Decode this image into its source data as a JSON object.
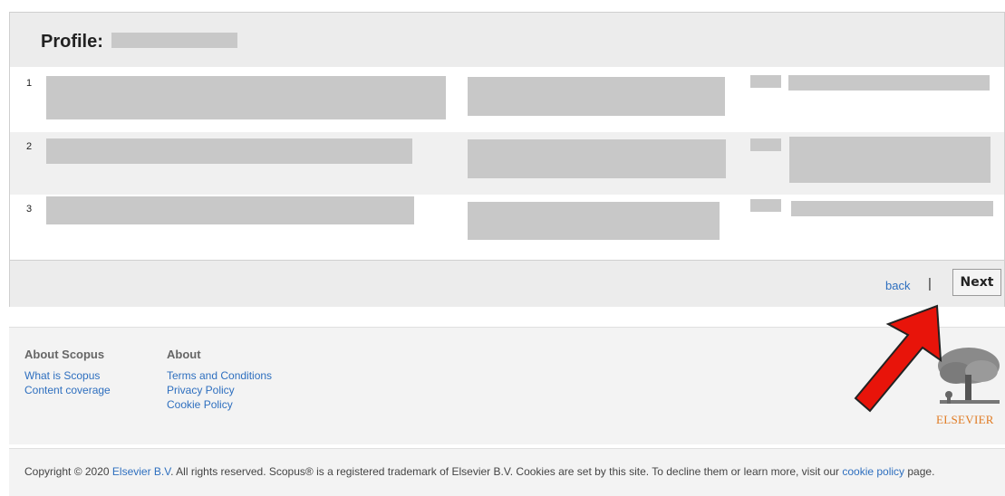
{
  "profile": {
    "label": "Profile:"
  },
  "rows": [
    {
      "num": "1"
    },
    {
      "num": "2"
    },
    {
      "num": "3"
    }
  ],
  "nav": {
    "back": "back",
    "separator": "|",
    "next": "Next"
  },
  "footer": {
    "about_scopus": {
      "title": "About Scopus",
      "links": [
        "What is Scopus",
        "Content coverage"
      ]
    },
    "about": {
      "title": "About",
      "links": [
        "Terms and Conditions",
        "Privacy Policy",
        "Cookie Policy"
      ]
    },
    "logo_text": "ELSEVIER"
  },
  "copyright": {
    "prefix": "Copyright © 2020 ",
    "company": "Elsevier B.V",
    "middle": ". All rights reserved. Scopus® is a registered trademark of Elsevier B.V. Cookies are set by this site. To decline them or learn more, visit our ",
    "cookie_link": "cookie policy",
    "suffix": " page."
  },
  "colors": {
    "link": "#2e6fbf",
    "arrow": "#e8140a",
    "logo": "#e07a21"
  },
  "icons": {
    "arrow": "red-arrow-annotation-icon",
    "logo": "elsevier-tree-logo-icon"
  }
}
